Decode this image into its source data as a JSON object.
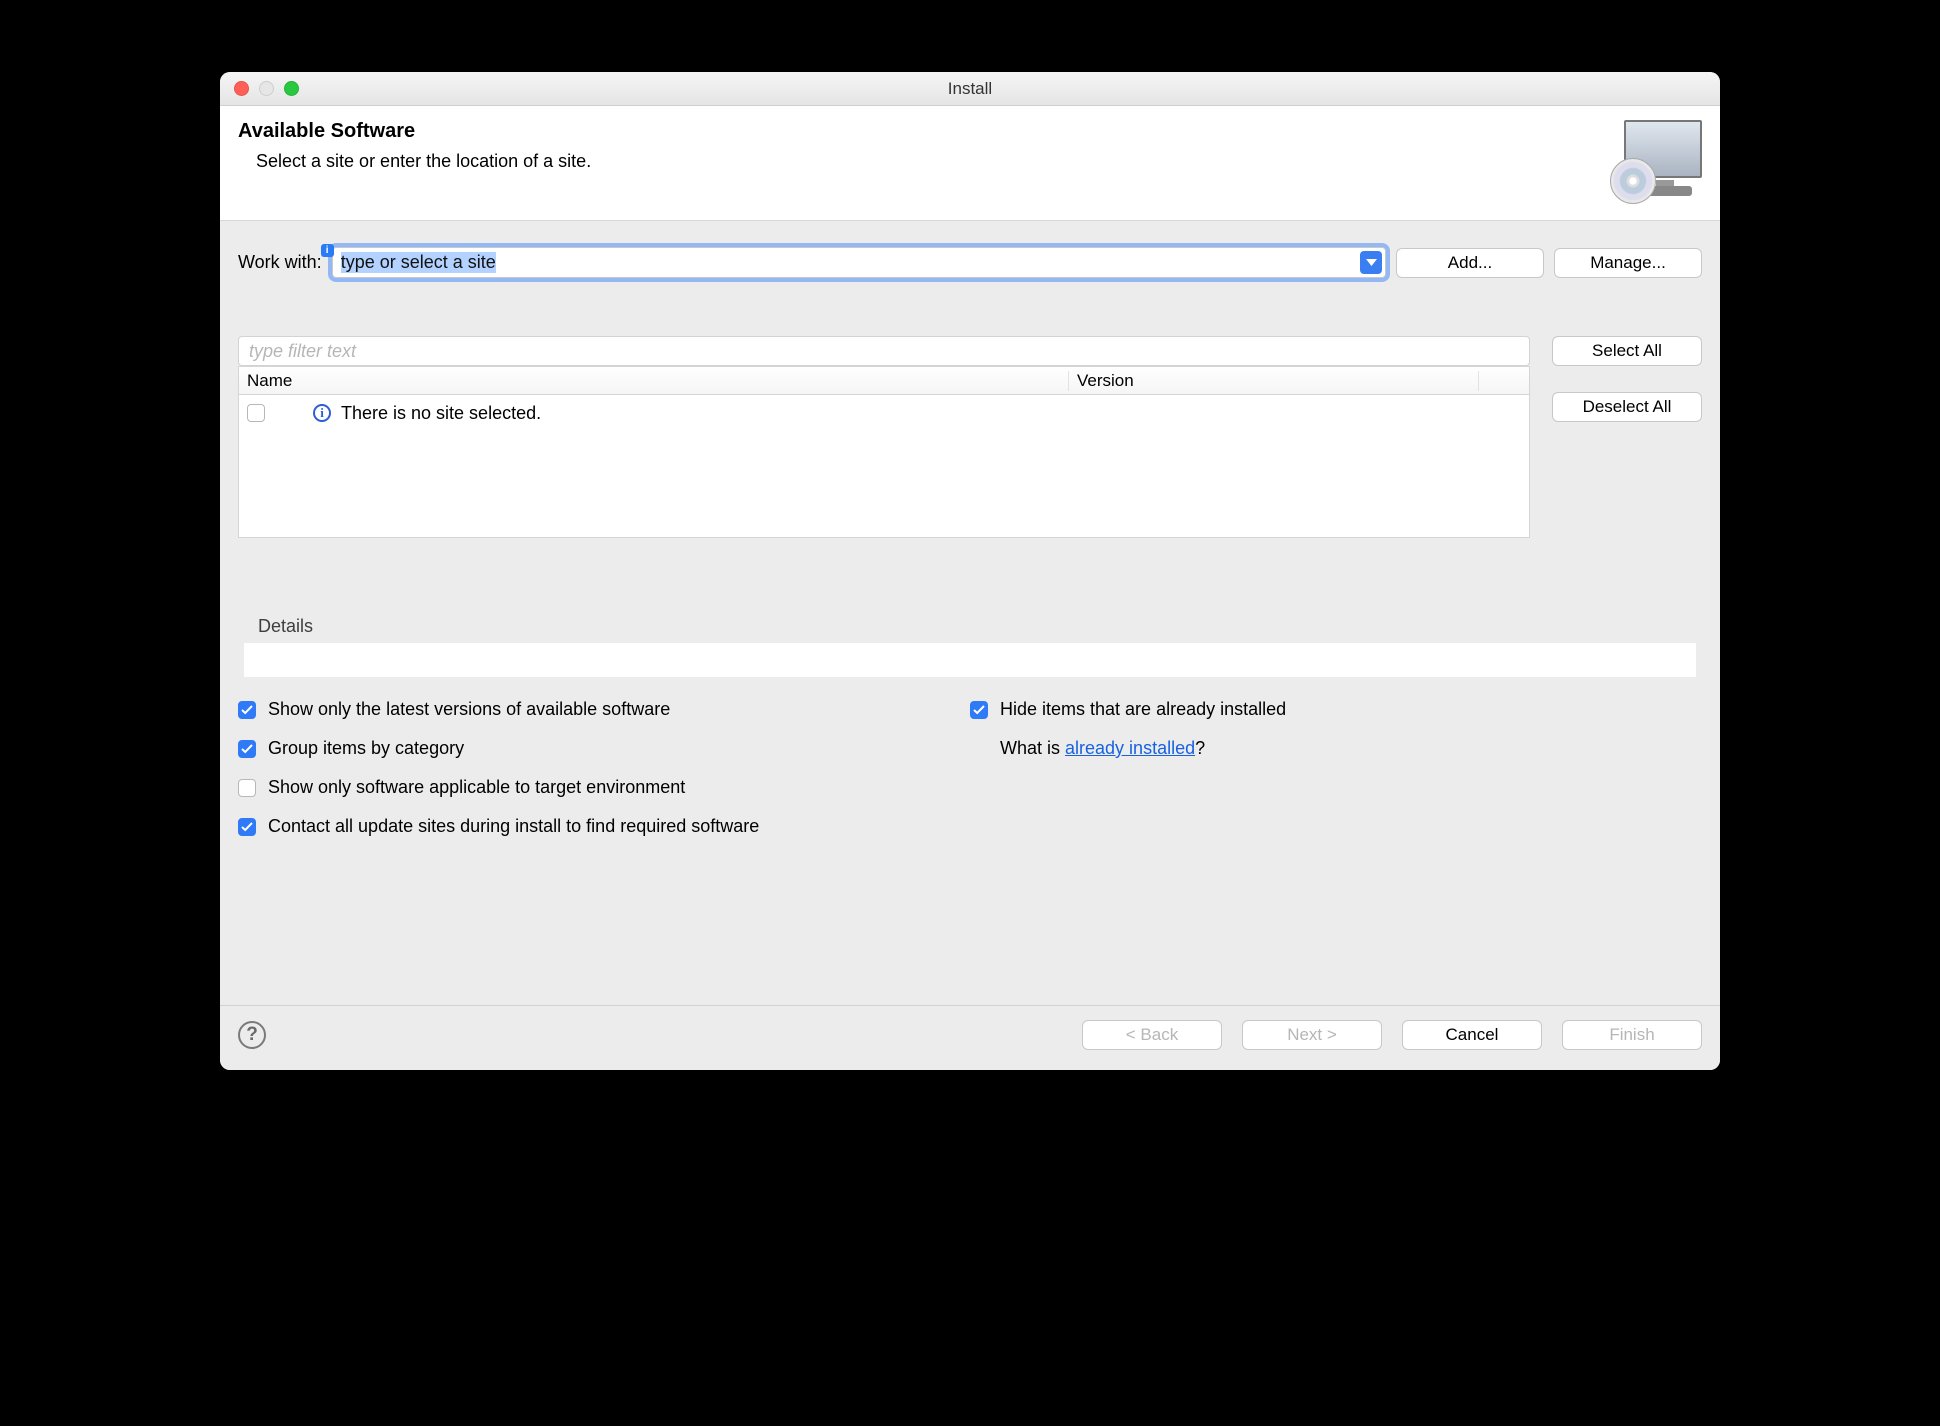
{
  "window": {
    "title": "Install"
  },
  "header": {
    "heading": "Available Software",
    "subtext": "Select a site or enter the location of a site."
  },
  "workWith": {
    "label": "Work with:",
    "value": "type or select a site",
    "addButton": "Add...",
    "manageButton": "Manage..."
  },
  "filter": {
    "placeholder": "type filter text"
  },
  "sideButtons": {
    "selectAll": "Select All",
    "deselectAll": "Deselect All"
  },
  "table": {
    "columns": {
      "name": "Name",
      "version": "Version"
    },
    "emptyMessage": "There is no site selected."
  },
  "details": {
    "label": "Details"
  },
  "options": {
    "showLatest": {
      "label": "Show only the latest versions of available software",
      "checked": true
    },
    "groupByCategory": {
      "label": "Group items by category",
      "checked": true
    },
    "applicableOnly": {
      "label": "Show only software applicable to target environment",
      "checked": false
    },
    "contactSites": {
      "label": "Contact all update sites during install to find required software",
      "checked": true
    },
    "hideInstalled": {
      "label": "Hide items that are already installed",
      "checked": true
    },
    "whatIsPrefix": "What is ",
    "whatIsLink": "already installed",
    "whatIsSuffix": "?"
  },
  "footer": {
    "back": "< Back",
    "next": "Next >",
    "cancel": "Cancel",
    "finish": "Finish"
  }
}
